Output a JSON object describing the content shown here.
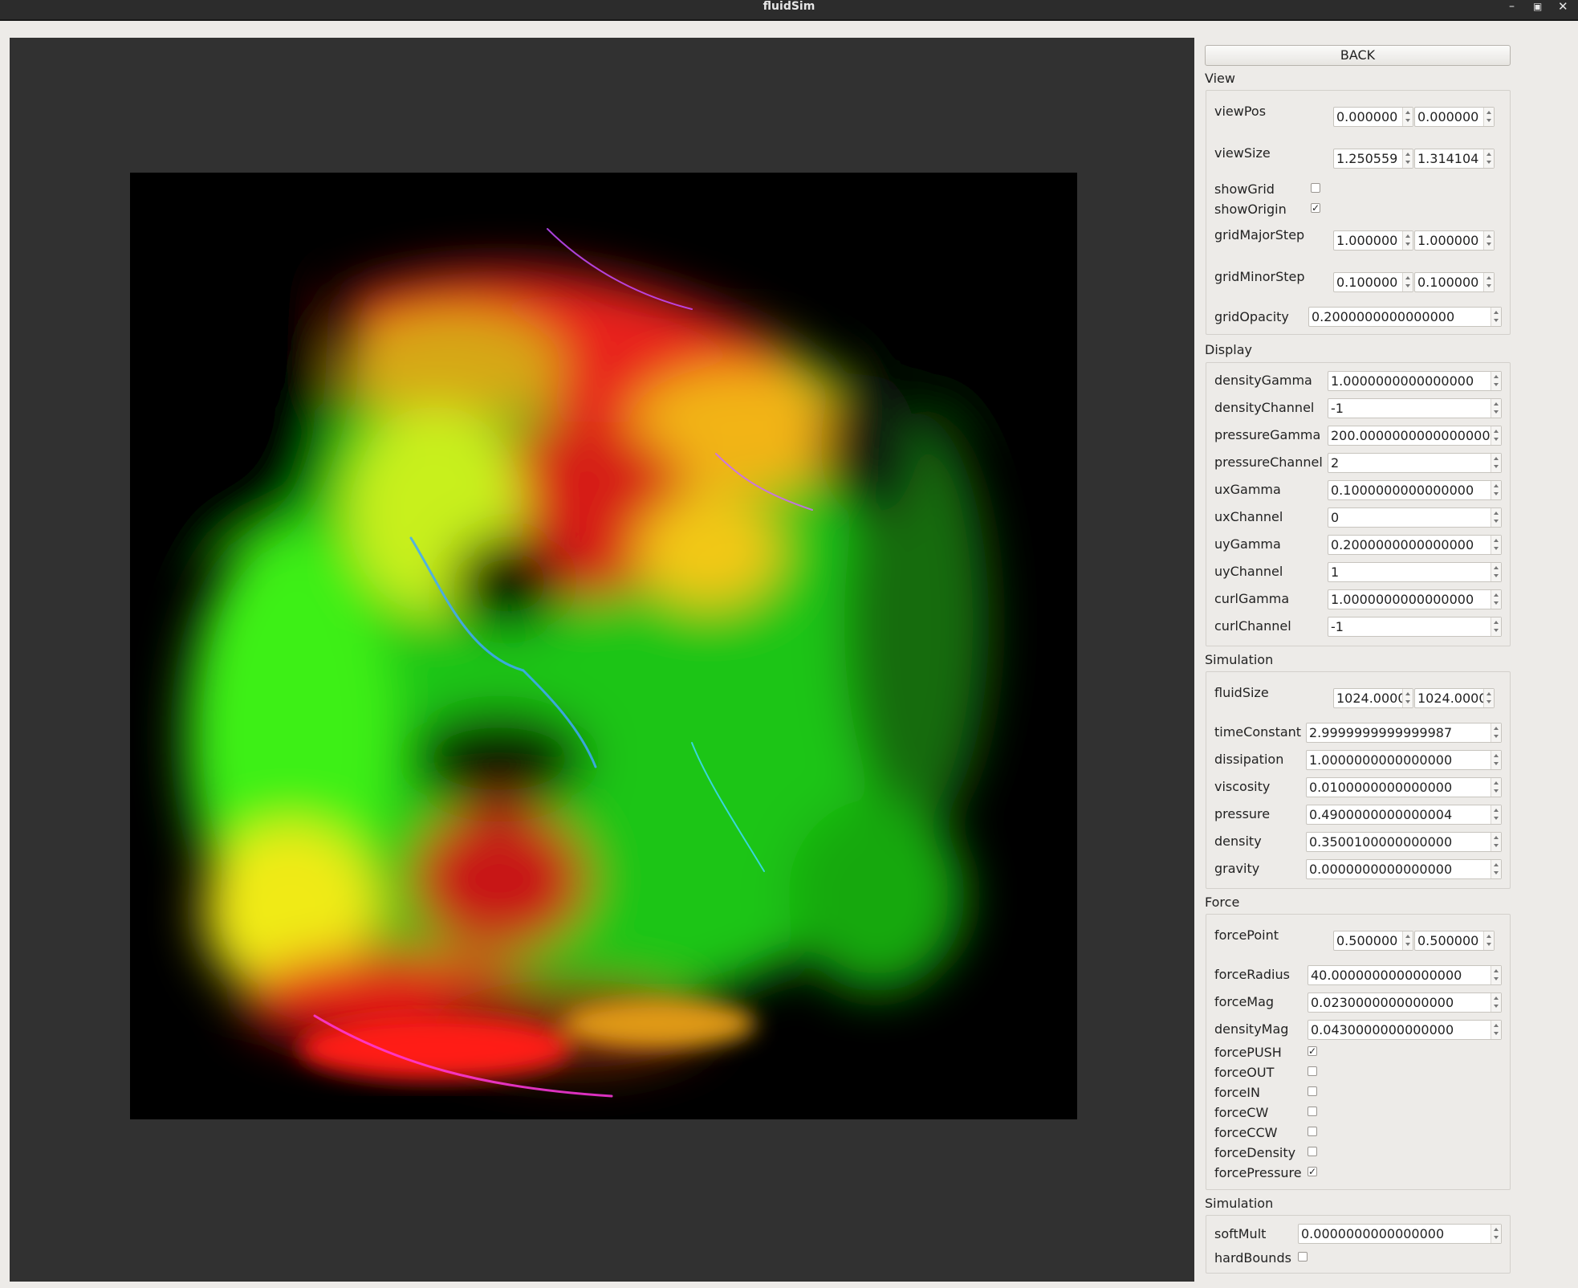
{
  "window": {
    "title": "fluidSim"
  },
  "back_label": "BACK",
  "sections": {
    "view": "View",
    "display": "Display",
    "simulation": "Simulation",
    "force": "Force",
    "simulation2": "Simulation"
  },
  "view": {
    "viewPos": {
      "label": "viewPos",
      "x": "0.000000",
      "y": "0.000000"
    },
    "viewSize": {
      "label": "viewSize",
      "x": "1.250559",
      "y": "1.314104"
    },
    "showGrid": {
      "label": "showGrid",
      "checked": false
    },
    "showOrigin": {
      "label": "showOrigin",
      "checked": true
    },
    "gridMajorStep": {
      "label": "gridMajorStep",
      "x": "1.000000",
      "y": "1.000000"
    },
    "gridMinorStep": {
      "label": "gridMinorStep",
      "x": "0.100000",
      "y": "0.100000"
    },
    "gridOpacity": {
      "label": "gridOpacity",
      "value": "0.2000000000000000"
    }
  },
  "display": [
    {
      "label": "densityGamma",
      "value": "1.0000000000000000"
    },
    {
      "label": "densityChannel",
      "value": "-1"
    },
    {
      "label": "pressureGamma",
      "value": "200.0000000000000000"
    },
    {
      "label": "pressureChannel",
      "value": "2"
    },
    {
      "label": "uxGamma",
      "value": "0.1000000000000000"
    },
    {
      "label": "uxChannel",
      "value": "0"
    },
    {
      "label": "uyGamma",
      "value": "0.2000000000000000"
    },
    {
      "label": "uyChannel",
      "value": "1"
    },
    {
      "label": "curlGamma",
      "value": "1.0000000000000000"
    },
    {
      "label": "curlChannel",
      "value": "-1"
    }
  ],
  "simulation": {
    "fluidSize": {
      "label": "fluidSize",
      "x": "1024.000000",
      "y": "1024.000000"
    },
    "fields": [
      {
        "label": "timeConstant",
        "value": "2.9999999999999987"
      },
      {
        "label": "dissipation",
        "value": "1.0000000000000000"
      },
      {
        "label": "viscosity",
        "value": "0.0100000000000000"
      },
      {
        "label": "pressure",
        "value": "0.4900000000000004"
      },
      {
        "label": "density",
        "value": "0.3500100000000000"
      },
      {
        "label": "gravity",
        "value": "0.0000000000000000"
      }
    ]
  },
  "force": {
    "forcePoint": {
      "label": "forcePoint",
      "x": "0.500000",
      "y": "0.500000"
    },
    "fields": [
      {
        "label": "forceRadius",
        "value": "40.0000000000000000"
      },
      {
        "label": "forceMag",
        "value": "0.0230000000000000"
      },
      {
        "label": "densityMag",
        "value": "0.0430000000000000"
      }
    ],
    "checks": [
      {
        "label": "forcePUSH",
        "checked": true
      },
      {
        "label": "forceOUT",
        "checked": false
      },
      {
        "label": "forceIN",
        "checked": false
      },
      {
        "label": "forceCW",
        "checked": false
      },
      {
        "label": "forceCCW",
        "checked": false
      },
      {
        "label": "forceDensity",
        "checked": false
      },
      {
        "label": "forcePressure",
        "checked": true
      }
    ]
  },
  "simulation2": {
    "softMult": {
      "label": "softMult",
      "value": "0.0000000000000000"
    },
    "hardBounds": {
      "label": "hardBounds",
      "checked": false
    }
  }
}
